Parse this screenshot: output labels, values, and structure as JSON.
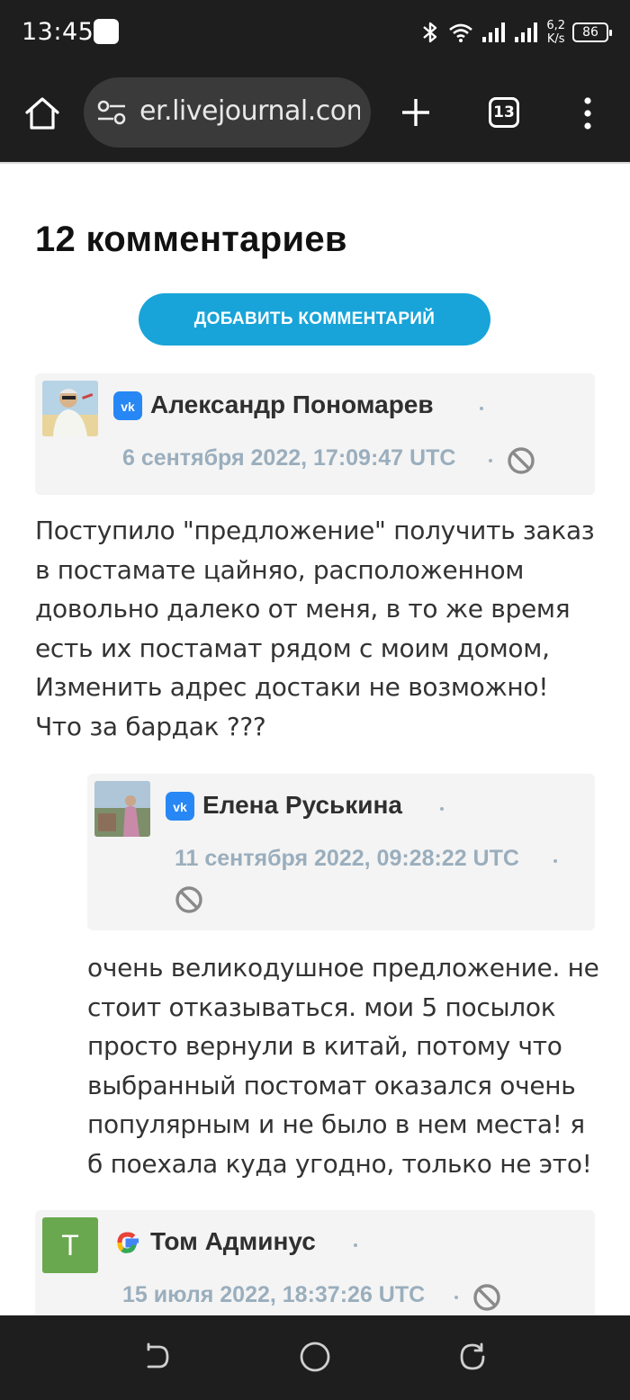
{
  "status_bar": {
    "time": "13:45",
    "speed_value": "6,2",
    "speed_unit": "K/s",
    "battery": "86"
  },
  "browser": {
    "url": "er.livejournal.com",
    "tab_count": "13"
  },
  "page": {
    "heading": "12 комментариев",
    "add_comment_label": "ДОБАВИТЬ КОММЕНТАРИЙ"
  },
  "comments": [
    {
      "author": "Александр Пономарев",
      "network_icon": "vk-icon",
      "date": "6 сентября 2022, 17:09:47 UTC",
      "text": "Поступило \"предложение\" получить заказ в постамате цайняо, расположенном довольно далеко от меня, в то же время есть их постамат рядом с моим домом, Изменить адрес достаки не возможно! Что за бардак ???"
    },
    {
      "author": "Елена Руськина",
      "network_icon": "vk-icon",
      "date": "11 сентября 2022, 09:28:22 UTC",
      "text": "очень великодушное предложение. не стоит отказываться. мои 5 посылок просто вернули в китай, потому что выбранный постомат оказался очень популярным и не было в нем места! я б поехала куда угодно, только не это!"
    },
    {
      "author": "Том Админус",
      "avatar_letter": "T",
      "network_icon": "google-icon",
      "date": "15 июля 2022, 18:37:26 UTC"
    }
  ],
  "colors": {
    "accent_button": "#18a4d9",
    "vk_blue": "#2787f5",
    "date_text": "#9aaebd",
    "avatar_green": "#6aa84f"
  }
}
